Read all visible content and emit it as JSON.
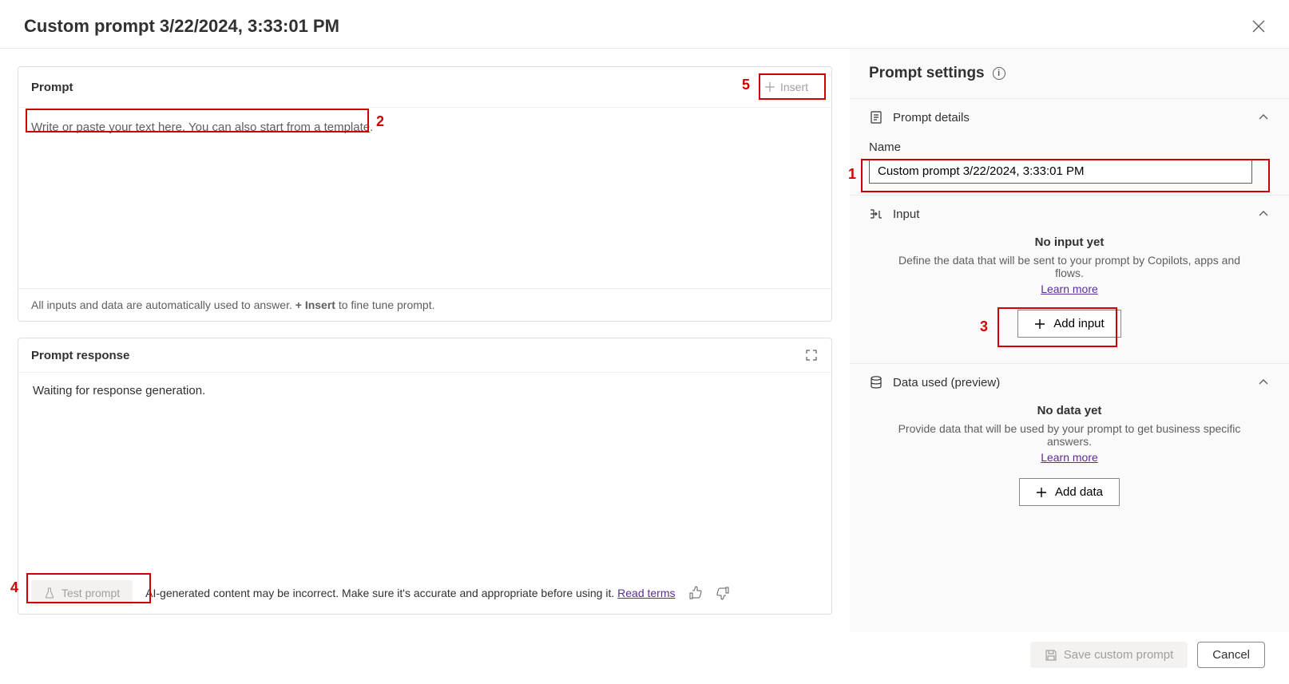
{
  "header": {
    "title": "Custom prompt 3/22/2024, 3:33:01 PM"
  },
  "prompt": {
    "title": "Prompt",
    "insert_label": "Insert",
    "placeholder_prefix": "Write or paste your text here. You can also ",
    "placeholder_link": "start from a template",
    "placeholder_suffix": ".",
    "help_prefix": "All inputs and data are automatically used to answer. ",
    "help_bold": "+ Insert",
    "help_suffix": " to fine tune prompt."
  },
  "response": {
    "title": "Prompt response",
    "body": "Waiting for response generation.",
    "test_label": "Test prompt",
    "disclaimer": "AI-generated content may be incorrect. Make sure it's accurate and appropriate before using it. ",
    "terms_link": "Read terms"
  },
  "settings": {
    "title": "Prompt settings",
    "details": {
      "title": "Prompt details",
      "name_label": "Name",
      "name_value": "Custom prompt 3/22/2024, 3:33:01 PM"
    },
    "input": {
      "title": "Input",
      "empty_title": "No input yet",
      "empty_desc": "Define the data that will be sent to your prompt by Copilots, apps and flows.",
      "learn_more": "Learn more",
      "add_label": "Add input"
    },
    "data": {
      "title": "Data used (preview)",
      "empty_title": "No data yet",
      "empty_desc": "Provide data that will be used by your prompt to get business specific answers.",
      "learn_more": "Learn more",
      "add_label": "Add data"
    }
  },
  "footer": {
    "save": "Save custom prompt",
    "cancel": "Cancel"
  },
  "callouts": {
    "n1": "1",
    "n2": "2",
    "n3": "3",
    "n4": "4",
    "n5": "5"
  }
}
